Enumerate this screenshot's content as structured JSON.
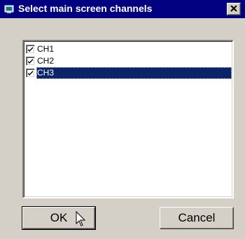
{
  "window": {
    "title": "Select main screen channels",
    "title_icon": "window-app-icon",
    "close_icon": "close-icon",
    "titlebar_color": "#000080",
    "face_color": "#d4d0c8"
  },
  "channel_list": {
    "items": [
      {
        "label": "CH1",
        "checked": true,
        "selected": false
      },
      {
        "label": "CH2",
        "checked": true,
        "selected": false
      },
      {
        "label": "CH3",
        "checked": true,
        "selected": true
      }
    ],
    "selection_color": "#0a246a"
  },
  "buttons": {
    "ok_label": "OK",
    "cancel_label": "Cancel"
  },
  "cursor": "arrow-pointer-icon"
}
